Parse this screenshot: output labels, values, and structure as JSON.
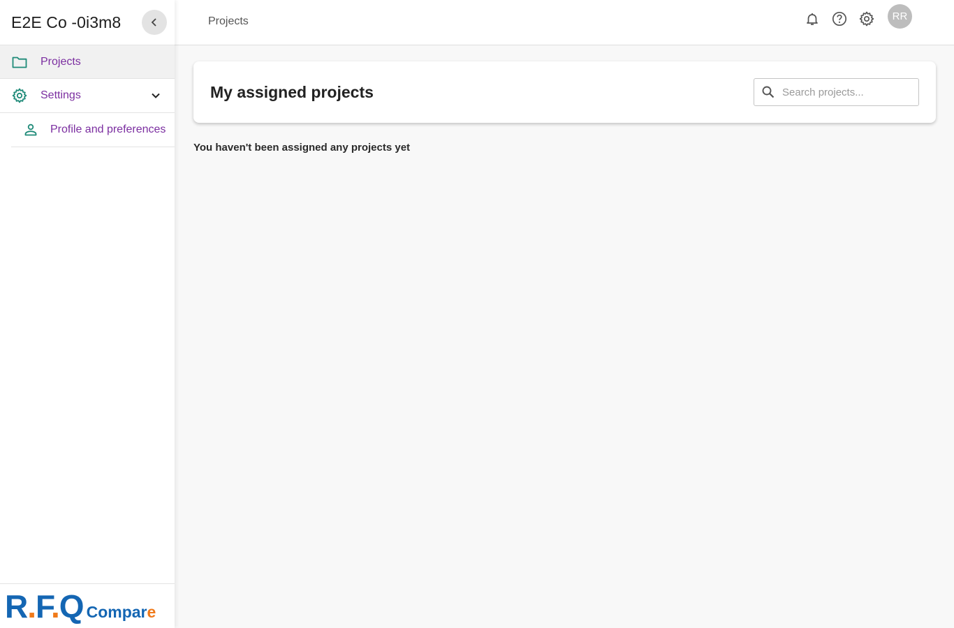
{
  "sidebar": {
    "org_name": "E2E Co -0i3m8",
    "collapse_icon": "chevron-left-icon",
    "items": [
      {
        "label": "Projects",
        "icon": "folder-icon"
      },
      {
        "label": "Settings",
        "icon": "gear-icon"
      }
    ],
    "sub_items": [
      {
        "label": "Profile and preferences",
        "icon": "person-icon"
      }
    ],
    "logo": {
      "main": "R.F.Q",
      "sub": "Compare"
    }
  },
  "topbar": {
    "breadcrumb": "Projects",
    "icons": [
      "bell-icon",
      "help-icon",
      "gear-icon"
    ],
    "avatar_initials": "RR"
  },
  "main": {
    "card_title": "My assigned projects",
    "search": {
      "placeholder": "Search projects...",
      "value": ""
    },
    "empty_message": "You haven't been assigned any projects yet"
  },
  "colors": {
    "nav_text": "#7b2ea0",
    "icon_teal": "#1e8a78",
    "logo_blue": "#1466b3",
    "logo_orange": "#f07a1a"
  }
}
